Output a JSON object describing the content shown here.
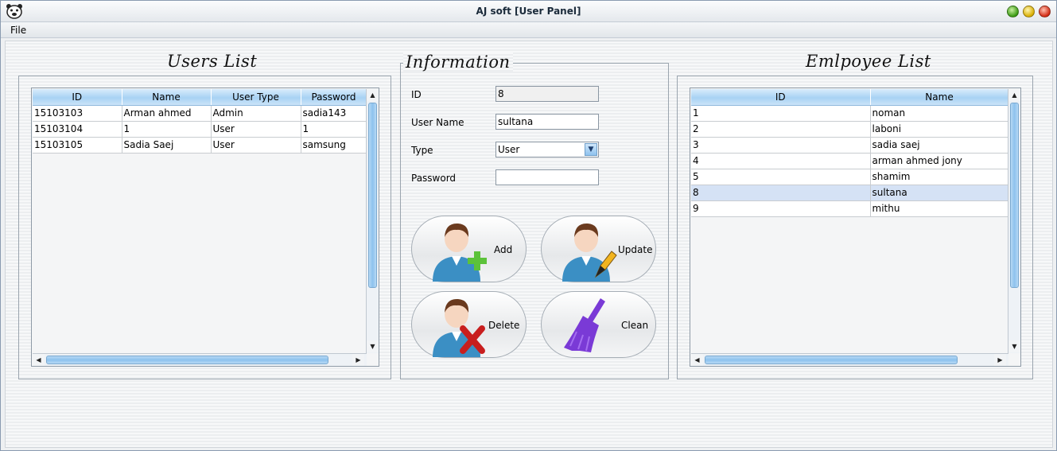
{
  "window": {
    "title": "AJ soft [User Panel]"
  },
  "menu": {
    "file": "File"
  },
  "users_panel": {
    "title": "Users List",
    "columns": [
      "ID",
      "Name",
      "User Type",
      "Password"
    ],
    "rows": [
      [
        "15103103",
        "Arman ahmed",
        "Admin",
        "sadia143"
      ],
      [
        "15103104",
        "1",
        "User",
        "1"
      ],
      [
        "15103105",
        "Sadia Saej",
        "User",
        "samsung"
      ]
    ]
  },
  "info_panel": {
    "title": "Information",
    "id_label": "ID",
    "id_value": "8",
    "username_label": "User Name",
    "username_value": "sultana",
    "type_label": "Type",
    "type_value": "User",
    "password_label": "Password",
    "password_value": "",
    "buttons": {
      "add": "Add",
      "update": "Update",
      "delete": "Delete",
      "clean": "Clean"
    }
  },
  "employee_panel": {
    "title": "Emlpoyee List",
    "columns": [
      "ID",
      "Name"
    ],
    "rows": [
      [
        "1",
        "noman"
      ],
      [
        "2",
        "laboni"
      ],
      [
        "3",
        "sadia saej"
      ],
      [
        "4",
        "arman ahmed jony"
      ],
      [
        "5",
        "shamim"
      ],
      [
        "8",
        "sultana"
      ],
      [
        "9",
        "mithu"
      ]
    ],
    "selected_row": 5
  },
  "icons": {
    "app": "bear-logo-icon",
    "add": "user-add-icon",
    "update": "user-edit-icon",
    "delete": "user-delete-icon",
    "clean": "broom-icon"
  },
  "colors": {
    "header_blue": "#a8d2f4",
    "selection": "#d5e2f5",
    "add_green": "#5cc23a",
    "delete_red": "#c81e1e",
    "broom_purple": "#7a3ad6"
  }
}
